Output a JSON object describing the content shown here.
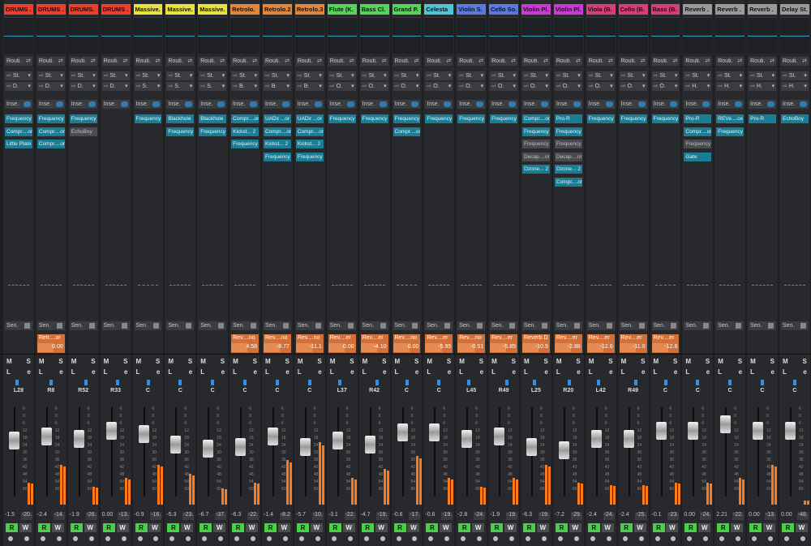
{
  "scale_marks": [
    "6",
    "0",
    "6",
    "12",
    "18",
    "24",
    "30",
    "36",
    "42",
    "48",
    "54",
    "60"
  ],
  "buttons": {
    "mute": "M",
    "solo": "S",
    "listen": "L",
    "edit": "e",
    "read": "R",
    "write": "W"
  },
  "labels": {
    "routing": "Routi.",
    "inserts": "Inse.",
    "sends": "Sen."
  },
  "channels": [
    {
      "name": "DRUMS .",
      "color": "#e8412f",
      "in": "St.",
      "out": "D.",
      "inserts": [
        "Frequency",
        "Compr....or",
        "Little Plate"
      ],
      "send": null,
      "pan": "L28",
      "vol": "-1.5",
      "peak": "-20.",
      "fader": 0.3,
      "meter": 0.25
    },
    {
      "name": "DRUMS .",
      "color": "#e8412f",
      "in": "St.",
      "out": "D.",
      "inserts": [
        "Frequency",
        "Compr....or",
        "Compr....or"
      ],
      "send": {
        "name": "Retr....or",
        "val": "0.00"
      },
      "pan": "R8",
      "vol": "-2.4",
      "peak": "-14.",
      "fader": 0.25,
      "meter": 0.45
    },
    {
      "name": "DRUMS.",
      "color": "#e8412f",
      "in": "St.",
      "out": "D.",
      "inserts": [
        "Frequency",
        "EchoBoy"
      ],
      "send": null,
      "pan": "R52",
      "vol": "-1.9",
      "peak": "-26.",
      "fader": 0.28,
      "meter": 0.2
    },
    {
      "name": "DRUMS .",
      "color": "#e8412f",
      "in": "St.",
      "out": "D.",
      "inserts": [],
      "send": null,
      "pan": "R33",
      "vol": "0.00",
      "peak": "-13.",
      "fader": 0.18,
      "meter": 0.3
    },
    {
      "name": "Massive.",
      "color": "#e9e23b",
      "in": "St.",
      "out": "S.",
      "inserts": [
        "Frequency"
      ],
      "send": null,
      "pan": "C",
      "vol": "-0.9",
      "peak": "-16.",
      "fader": 0.22,
      "meter": 0.45
    },
    {
      "name": "Massive.",
      "color": "#e9e23b",
      "in": "St.",
      "out": "S.",
      "inserts": [
        "Blackhole",
        "Frequency"
      ],
      "send": null,
      "pan": "C",
      "vol": "-5.3",
      "peak": "-23.",
      "fader": 0.35,
      "meter": 0.35
    },
    {
      "name": "Massive.",
      "color": "#e9e23b",
      "in": "St.",
      "out": "S.",
      "inserts": [
        "Blackhole",
        "Frequency"
      ],
      "send": null,
      "pan": "C",
      "vol": "-6.7",
      "peak": "-37.",
      "fader": 0.4,
      "meter": 0.18
    },
    {
      "name": "Retrolo.",
      "color": "#e2863a",
      "in": "St.",
      "out": "B.",
      "inserts": [
        "Compr....or",
        "Kickst... 2",
        "Frequency"
      ],
      "send": {
        "name": "Rev....no",
        "val": "4.58"
      },
      "pan": "C",
      "vol": "-6.3",
      "peak": "-22.",
      "fader": 0.38,
      "meter": 0.25
    },
    {
      "name": "Retrolo.2",
      "color": "#e2863a",
      "in": "St.",
      "out": "B.",
      "inserts": [
        "UADx ...or",
        "Compr....or",
        "Kickst... 2",
        "Frequency"
      ],
      "send": {
        "name": "Rev....no",
        "val": "-8.77"
      },
      "pan": "C",
      "vol": "-1.4",
      "peak": "-8.2",
      "fader": 0.25,
      "meter": 0.5
    },
    {
      "name": "Retrolo.3",
      "color": "#e2863a",
      "in": "St.",
      "out": "B.",
      "inserts": [
        "UADx ...or",
        "Compr....or",
        "Kickst... 2",
        "Frequency"
      ],
      "send": {
        "name": "Rev....no",
        "val": "-11.1"
      },
      "pan": "C",
      "vol": "-5.7",
      "peak": "-10.",
      "fader": 0.38,
      "meter": 0.7
    },
    {
      "name": "Flute (K.",
      "color": "#56d45a",
      "in": "St.",
      "out": "O.",
      "inserts": [
        "Frequency"
      ],
      "send": {
        "name": "Rev....er",
        "val": "0.00"
      },
      "pan": "L37",
      "vol": "-3.1",
      "peak": "-22.",
      "fader": 0.3,
      "meter": 0.3
    },
    {
      "name": "Bass Cl.",
      "color": "#56d45a",
      "in": "St.",
      "out": "O.",
      "inserts": [
        "Frequency"
      ],
      "send": {
        "name": "Rev....er",
        "val": "-4.10"
      },
      "pan": "R42",
      "vol": "-4.7",
      "peak": "-19.",
      "fader": 0.35,
      "meter": 0.4
    },
    {
      "name": "Grand P.",
      "color": "#56d45a",
      "in": "St.",
      "out": "O.",
      "inserts": [
        "Frequency",
        "Compr....or"
      ],
      "send": {
        "name": "Rev....no",
        "val": "0.00"
      },
      "pan": "C",
      "vol": "-0.6",
      "peak": "-17.",
      "fader": 0.2,
      "meter": 0.55
    },
    {
      "name": "Celesta",
      "color": "#4fc6d6",
      "in": "St.",
      "out": "O.",
      "inserts": [
        "Frequency"
      ],
      "send": {
        "name": "Rev....er",
        "val": "-5.95"
      },
      "pan": "C",
      "vol": "-0.6",
      "peak": "-19.",
      "fader": 0.2,
      "meter": 0.3
    },
    {
      "name": "Violin S.",
      "color": "#5a7ae0",
      "in": "St.",
      "out": "O.",
      "inserts": [
        "Frequency"
      ],
      "send": {
        "name": "Rev....no",
        "val": "-0.51"
      },
      "pan": "L45",
      "vol": "-2.8",
      "peak": "-24.",
      "fader": 0.28,
      "meter": 0.2
    },
    {
      "name": "Cello So.",
      "color": "#5a7ae0",
      "in": "St.",
      "out": "O.",
      "inserts": [
        "Frequency"
      ],
      "send": {
        "name": "Rev....er",
        "val": "-5.85"
      },
      "pan": "R49",
      "vol": "-1.9",
      "peak": "-19.",
      "fader": 0.25,
      "meter": 0.3
    },
    {
      "name": "Violin Pl.",
      "color": "#c93bd7",
      "in": "St.",
      "out": "O.",
      "inserts": [
        "Compr....or",
        "Frequency",
        "Frequency",
        "Decap....or",
        "Ozone... 2"
      ],
      "send": {
        "name": "Reverb D",
        "val": "-10.5"
      },
      "pan": "L25",
      "vol": "-6.3",
      "peak": "-19.",
      "fader": 0.38,
      "meter": 0.45
    },
    {
      "name": "Violin Pl.",
      "color": "#c93bd7",
      "in": "St.",
      "out": "O.",
      "inserts": [
        "Pro-R",
        "Frequency",
        "Frequency",
        "Decap....or",
        "Ozone... 2",
        "Compr....or"
      ],
      "send": {
        "name": "Rev....er",
        "val": "-2.88"
      },
      "pan": "R20",
      "vol": "-7.2",
      "peak": "-29.",
      "fader": 0.42,
      "meter": 0.25
    },
    {
      "name": "Viola (B.",
      "color": "#d63f7c",
      "in": "St.",
      "out": "O.",
      "inserts": [
        "Frequency"
      ],
      "send": {
        "name": "Rev....er",
        "val": "-12.6"
      },
      "pan": "L42",
      "vol": "-2.4",
      "peak": "-24.",
      "fader": 0.28,
      "meter": 0.22
    },
    {
      "name": "Cello (B.",
      "color": "#d63f7c",
      "in": "St.",
      "out": "O.",
      "inserts": [
        "Frequency"
      ],
      "send": {
        "name": "Rev....er",
        "val": "-11.0"
      },
      "pan": "R49",
      "vol": "-2.4",
      "peak": "-25.",
      "fader": 0.28,
      "meter": 0.22
    },
    {
      "name": "Bass (B.",
      "color": "#d63f7c",
      "in": "St.",
      "out": "O.",
      "inserts": [
        "Frequency"
      ],
      "send": {
        "name": "Rev....er",
        "val": "-12.6"
      },
      "pan": "C",
      "vol": "-0.1",
      "peak": "-23.",
      "fader": 0.18,
      "meter": 0.25
    },
    {
      "name": "Reverb .",
      "color": "#9a9a9a",
      "in": "St.",
      "out": "H.",
      "inserts": [
        "Pro-R",
        "Compr....or",
        "Frequency",
        "Gate"
      ],
      "send": null,
      "pan": "C",
      "vol": "0.00",
      "peak": "-24.",
      "fader": 0.18,
      "meter": 0.25
    },
    {
      "name": "Reverb .",
      "color": "#9a9a9a",
      "in": "St.",
      "out": "H.",
      "inserts": [
        "REVe....ce",
        "Frequency"
      ],
      "send": null,
      "pan": "C",
      "vol": "2.21",
      "peak": "-22.",
      "fader": 0.1,
      "meter": 0.3
    },
    {
      "name": "Reverb .",
      "color": "#9a9a9a",
      "in": "St.",
      "out": "H.",
      "inserts": [
        "Pro-R"
      ],
      "send": null,
      "pan": "C",
      "vol": "0.00",
      "peak": "-13.",
      "fader": 0.18,
      "meter": 0.45
    },
    {
      "name": "Delay St.",
      "color": "#9a9a9a",
      "in": "St.",
      "out": "H.",
      "inserts": [
        "EchoBoy"
      ],
      "send": null,
      "pan": "C",
      "vol": "0.00",
      "peak": "-48.",
      "fader": 0.18,
      "meter": 0.05
    }
  ]
}
